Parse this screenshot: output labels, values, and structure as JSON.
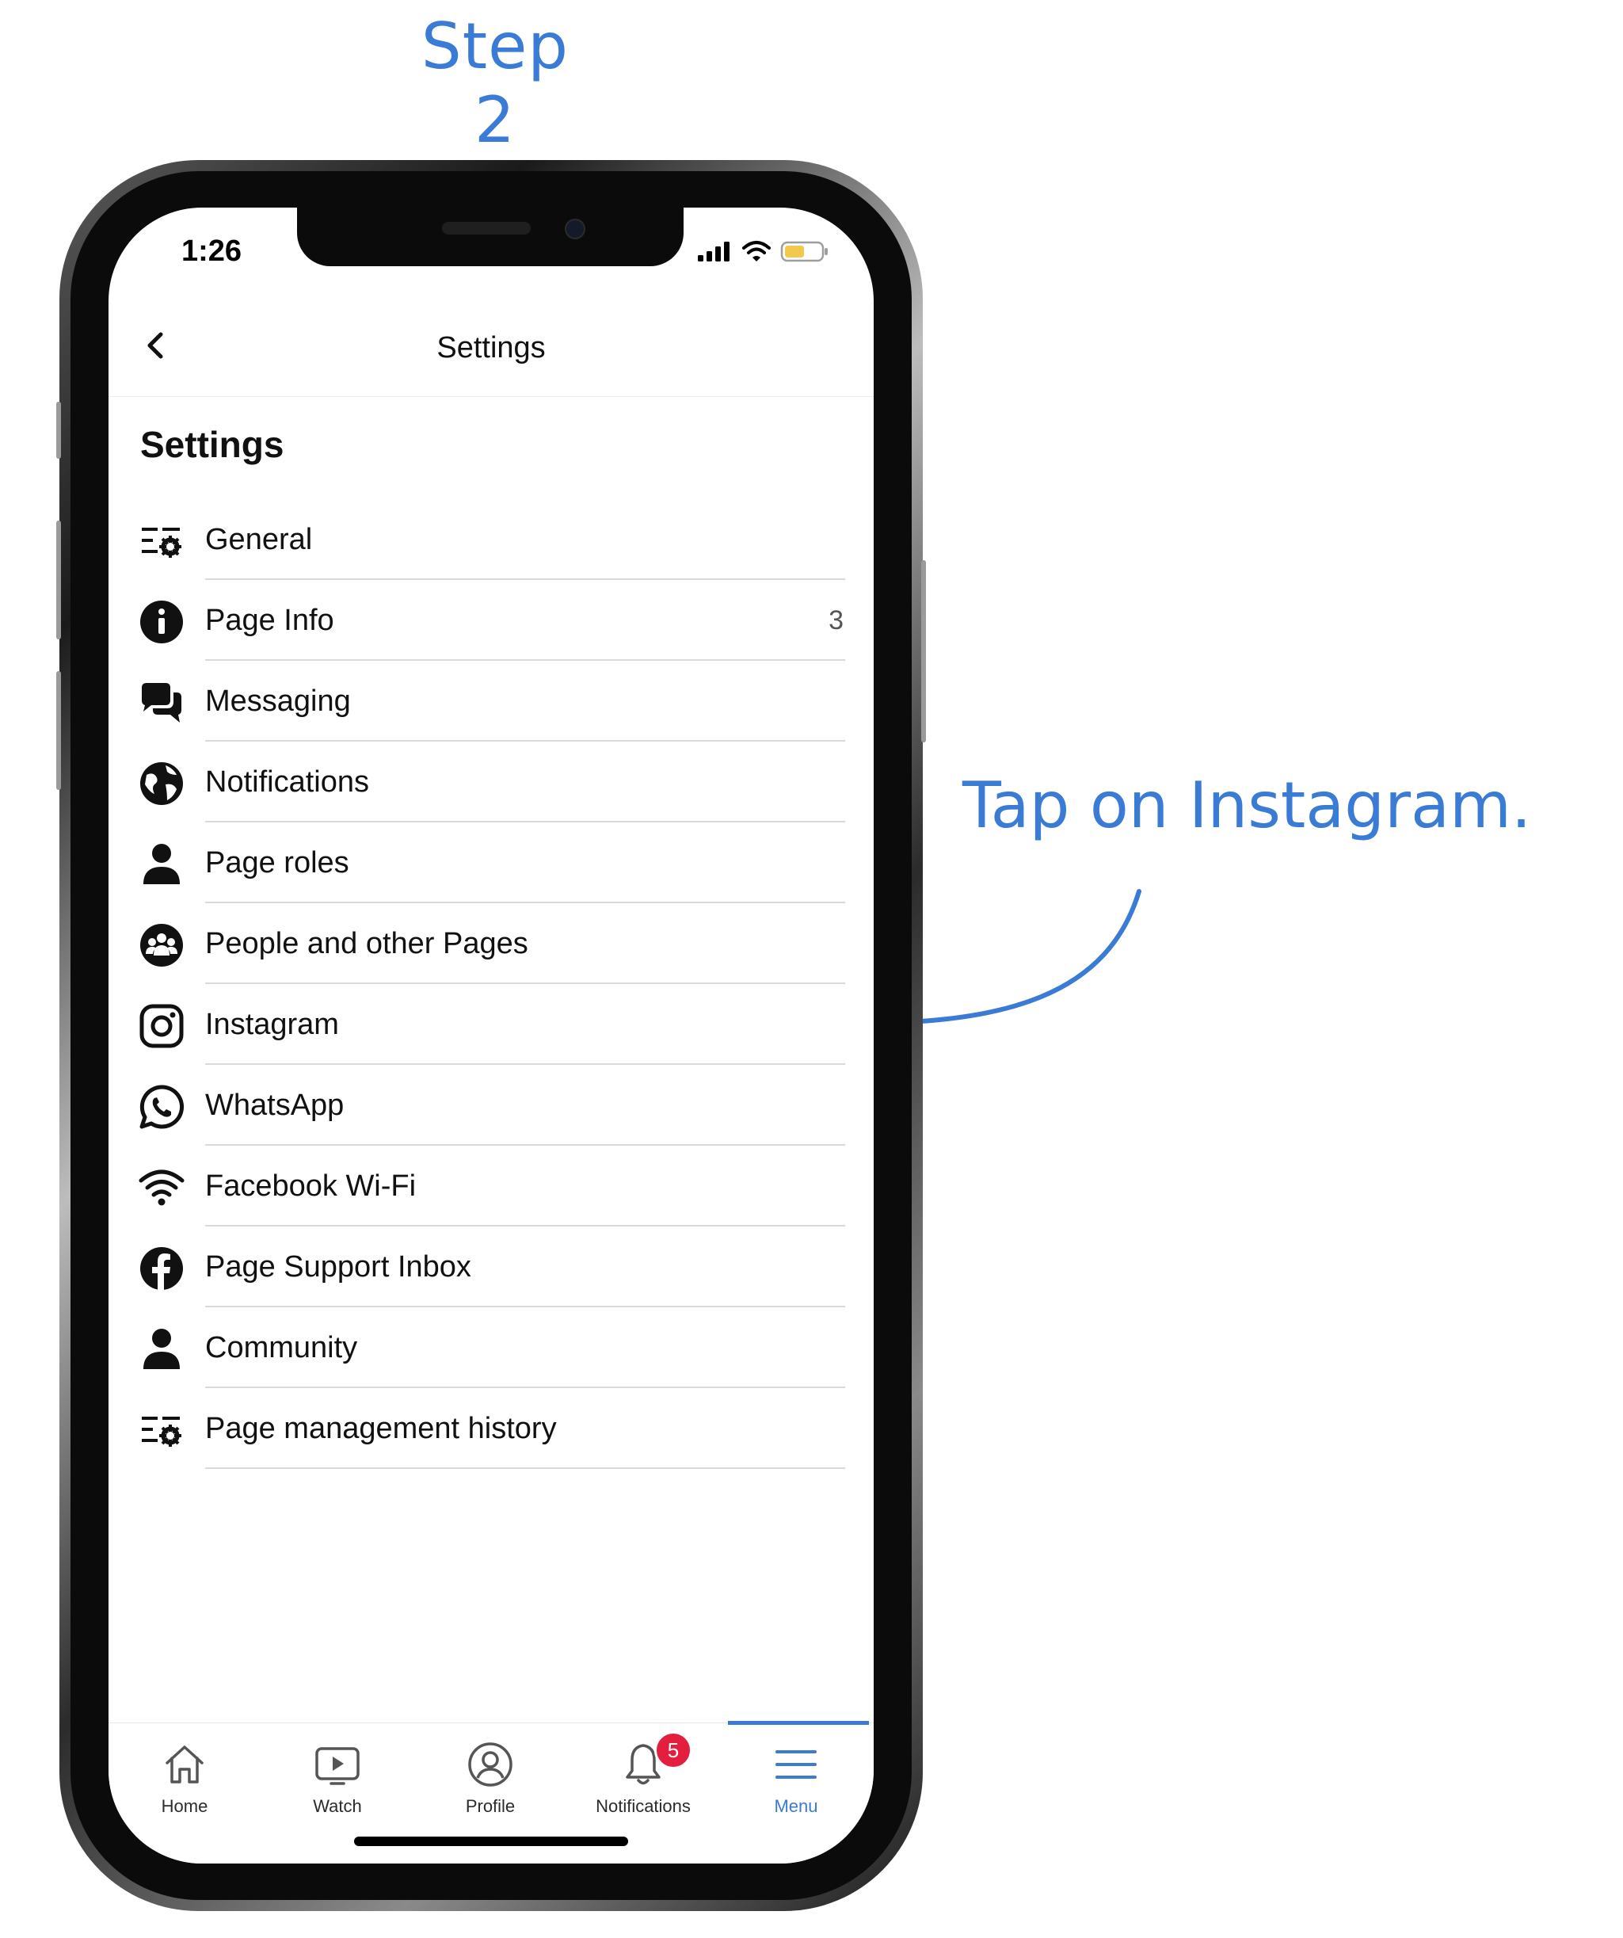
{
  "annotation": {
    "step_title": "Step 2",
    "instruction": "Tap on Instagram.",
    "color": "#3a7bd5"
  },
  "status_bar": {
    "time": "1:26",
    "icons": [
      "cellular-signal-icon",
      "wifi-icon",
      "battery-icon"
    ]
  },
  "nav_bar": {
    "title": "Settings",
    "back_icon": "chevron-left-icon"
  },
  "section": {
    "heading": "Settings"
  },
  "settings_items": [
    {
      "label": "General",
      "icon": "settings-list-icon",
      "count": ""
    },
    {
      "label": "Page Info",
      "icon": "info-icon",
      "count": "3"
    },
    {
      "label": "Messaging",
      "icon": "chat-bubbles-icon",
      "count": ""
    },
    {
      "label": "Notifications",
      "icon": "globe-icon",
      "count": ""
    },
    {
      "label": "Page roles",
      "icon": "person-icon",
      "count": ""
    },
    {
      "label": "People and other Pages",
      "icon": "group-icon",
      "count": ""
    },
    {
      "label": "Instagram",
      "icon": "instagram-icon",
      "count": ""
    },
    {
      "label": "WhatsApp",
      "icon": "whatsapp-icon",
      "count": ""
    },
    {
      "label": "Facebook Wi-Fi",
      "icon": "wifi-icon",
      "count": ""
    },
    {
      "label": "Page Support Inbox",
      "icon": "facebook-icon",
      "count": ""
    },
    {
      "label": "Community",
      "icon": "person-icon",
      "count": ""
    },
    {
      "label": "Page management history",
      "icon": "settings-list-icon",
      "count": ""
    }
  ],
  "tab_bar": {
    "tabs": [
      {
        "label": "Home",
        "icon": "home-icon",
        "active": false
      },
      {
        "label": "Watch",
        "icon": "video-play-icon",
        "active": false
      },
      {
        "label": "Profile",
        "icon": "profile-icon",
        "active": false
      },
      {
        "label": "Notifications",
        "icon": "bell-icon",
        "active": false,
        "badge": "5"
      },
      {
        "label": "Menu",
        "icon": "hamburger-menu-icon",
        "active": true
      }
    ]
  },
  "colors": {
    "accent": "#3a7bd5",
    "badge": "#e41e3f",
    "battery": "#f2c94c"
  }
}
